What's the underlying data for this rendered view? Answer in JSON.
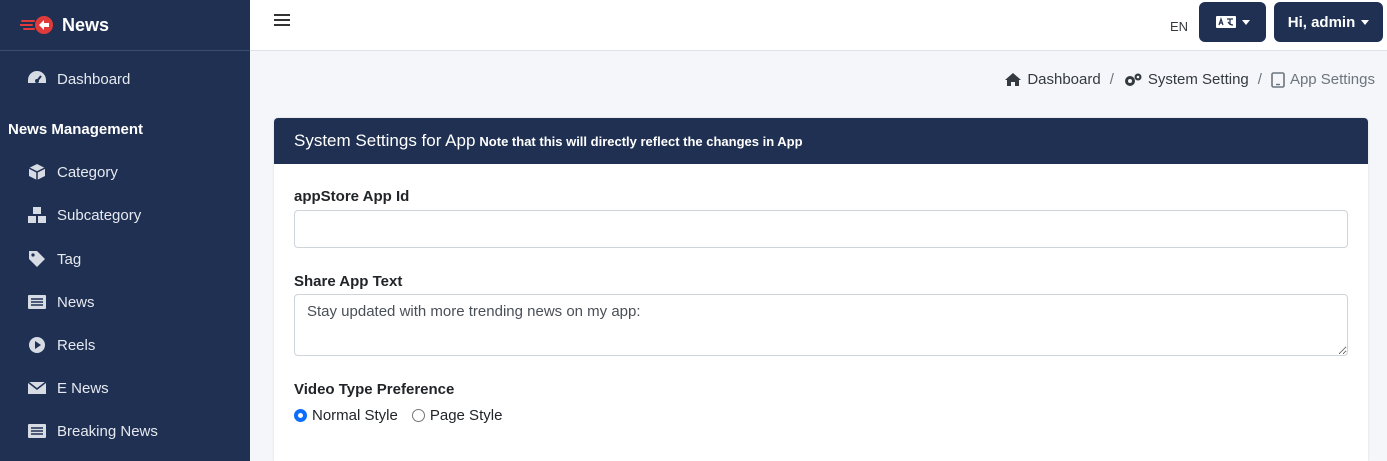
{
  "brand": {
    "title": "News"
  },
  "sidebar": {
    "dashboard": "Dashboard",
    "section_header": "News Management",
    "items": [
      {
        "label": "Category",
        "icon": "cube-icon"
      },
      {
        "label": "Subcategory",
        "icon": "cubes-icon"
      },
      {
        "label": "Tag",
        "icon": "tag-icon"
      },
      {
        "label": "News",
        "icon": "newspaper-icon"
      },
      {
        "label": "Reels",
        "icon": "play-circle-icon"
      },
      {
        "label": "E News",
        "icon": "envelope-icon"
      },
      {
        "label": "Breaking News",
        "icon": "newspaper-icon"
      }
    ]
  },
  "topbar": {
    "lang": "EN",
    "user_label": "Hi, admin"
  },
  "breadcrumb": {
    "items": [
      "Dashboard",
      "System Setting",
      "App Settings"
    ],
    "separator": "/"
  },
  "card": {
    "title": "System Settings for App",
    "note": "Note that this will directly reflect the changes in App"
  },
  "form": {
    "appstore_label": "appStore App Id",
    "appstore_value": "",
    "share_label": "Share App Text",
    "share_value": "Stay updated with more trending news on my app:",
    "video_label": "Video Type Preference",
    "video_options": [
      "Normal Style",
      "Page Style"
    ],
    "video_selected": "Normal Style"
  },
  "colors": {
    "primary": "#1f3052",
    "accent": "#e03b3b",
    "radio": "#0d6efd"
  }
}
